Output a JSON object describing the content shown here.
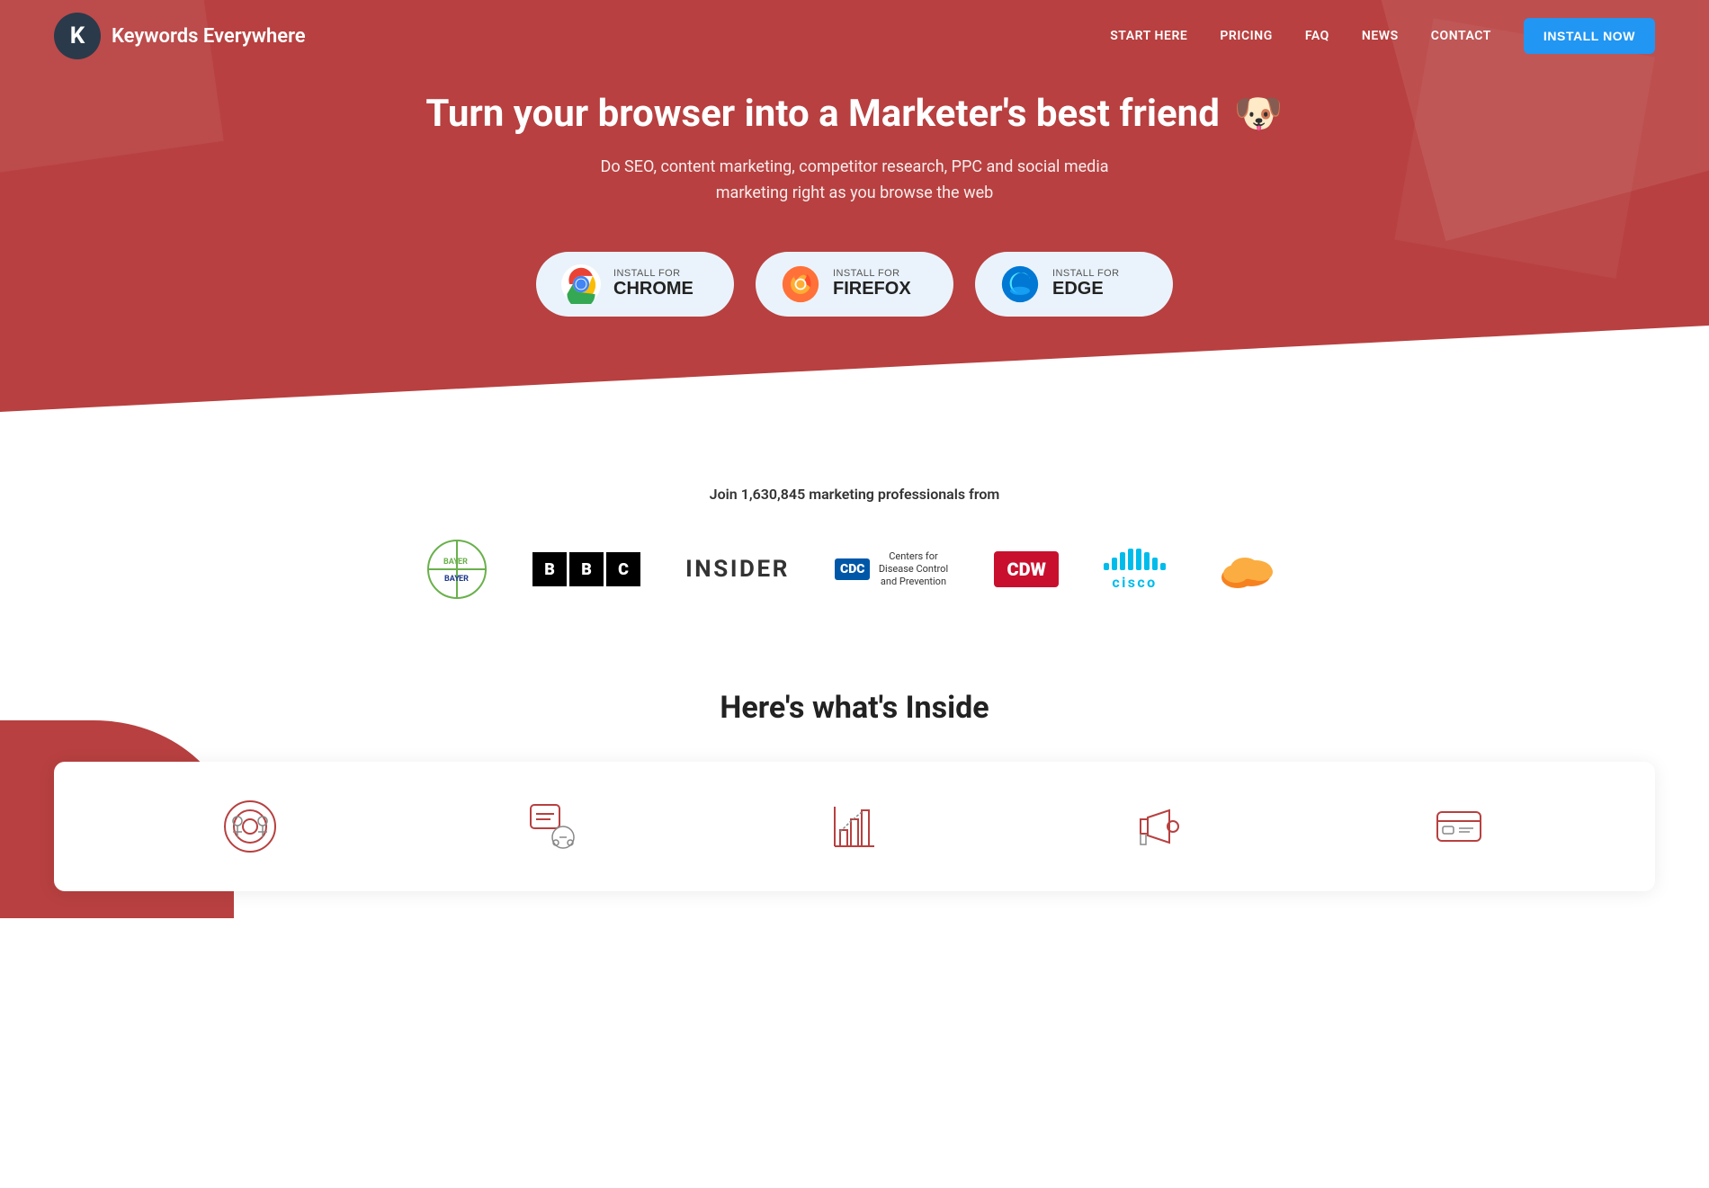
{
  "brand": {
    "letter": "K",
    "name": "Keywords Everywhere"
  },
  "nav": {
    "links": [
      {
        "label": "START HERE",
        "id": "start-here"
      },
      {
        "label": "PRICING",
        "id": "pricing"
      },
      {
        "label": "FAQ",
        "id": "faq"
      },
      {
        "label": "NEWS",
        "id": "news"
      },
      {
        "label": "CONTACT",
        "id": "contact"
      }
    ],
    "install_btn": "INSTALL NOW"
  },
  "hero": {
    "title": "Turn your browser into a Marketer's best friend",
    "dog_emoji": "🐶",
    "subtitle": "Do SEO, content marketing, competitor research, PPC and social media marketing right as you browse the web",
    "install_buttons": [
      {
        "label_small": "INSTALL FOR",
        "label_big": "CHROME",
        "id": "chrome"
      },
      {
        "label_small": "INSTALL FOR",
        "label_big": "FIREFOX",
        "id": "firefox"
      },
      {
        "label_small": "INSTALL FOR",
        "label_big": "EDGE",
        "id": "edge"
      }
    ]
  },
  "social_proof": {
    "text": "Join 1,630,845 marketing professionals from",
    "logos": [
      {
        "name": "Bayer",
        "id": "bayer"
      },
      {
        "name": "BBC",
        "id": "bbc"
      },
      {
        "name": "INSIDER",
        "id": "insider"
      },
      {
        "name": "CDC",
        "id": "cdc"
      },
      {
        "name": "CDW",
        "id": "cdw"
      },
      {
        "name": "Cisco",
        "id": "cisco"
      },
      {
        "name": "Cloudflare",
        "id": "cloudflare"
      }
    ]
  },
  "whats_inside": {
    "title": "Here's what's Inside"
  }
}
